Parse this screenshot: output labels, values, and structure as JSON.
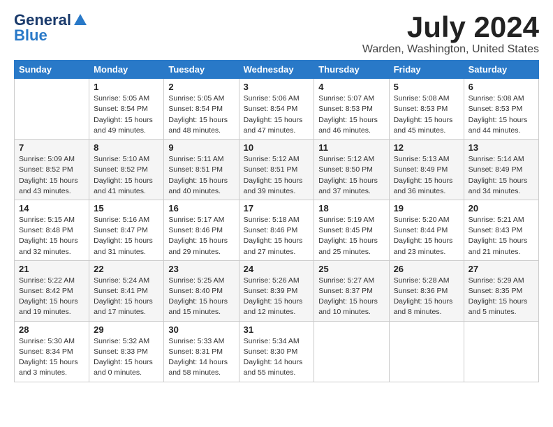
{
  "logo": {
    "line1": "General",
    "line2": "Blue"
  },
  "title": "July 2024",
  "location": "Warden, Washington, United States",
  "headers": [
    "Sunday",
    "Monday",
    "Tuesday",
    "Wednesday",
    "Thursday",
    "Friday",
    "Saturday"
  ],
  "weeks": [
    [
      {
        "day": "",
        "sunrise": "",
        "sunset": "",
        "daylight": ""
      },
      {
        "day": "1",
        "sunrise": "Sunrise: 5:05 AM",
        "sunset": "Sunset: 8:54 PM",
        "daylight": "Daylight: 15 hours and 49 minutes."
      },
      {
        "day": "2",
        "sunrise": "Sunrise: 5:05 AM",
        "sunset": "Sunset: 8:54 PM",
        "daylight": "Daylight: 15 hours and 48 minutes."
      },
      {
        "day": "3",
        "sunrise": "Sunrise: 5:06 AM",
        "sunset": "Sunset: 8:54 PM",
        "daylight": "Daylight: 15 hours and 47 minutes."
      },
      {
        "day": "4",
        "sunrise": "Sunrise: 5:07 AM",
        "sunset": "Sunset: 8:53 PM",
        "daylight": "Daylight: 15 hours and 46 minutes."
      },
      {
        "day": "5",
        "sunrise": "Sunrise: 5:08 AM",
        "sunset": "Sunset: 8:53 PM",
        "daylight": "Daylight: 15 hours and 45 minutes."
      },
      {
        "day": "6",
        "sunrise": "Sunrise: 5:08 AM",
        "sunset": "Sunset: 8:53 PM",
        "daylight": "Daylight: 15 hours and 44 minutes."
      }
    ],
    [
      {
        "day": "7",
        "sunrise": "Sunrise: 5:09 AM",
        "sunset": "Sunset: 8:52 PM",
        "daylight": "Daylight: 15 hours and 43 minutes."
      },
      {
        "day": "8",
        "sunrise": "Sunrise: 5:10 AM",
        "sunset": "Sunset: 8:52 PM",
        "daylight": "Daylight: 15 hours and 41 minutes."
      },
      {
        "day": "9",
        "sunrise": "Sunrise: 5:11 AM",
        "sunset": "Sunset: 8:51 PM",
        "daylight": "Daylight: 15 hours and 40 minutes."
      },
      {
        "day": "10",
        "sunrise": "Sunrise: 5:12 AM",
        "sunset": "Sunset: 8:51 PM",
        "daylight": "Daylight: 15 hours and 39 minutes."
      },
      {
        "day": "11",
        "sunrise": "Sunrise: 5:12 AM",
        "sunset": "Sunset: 8:50 PM",
        "daylight": "Daylight: 15 hours and 37 minutes."
      },
      {
        "day": "12",
        "sunrise": "Sunrise: 5:13 AM",
        "sunset": "Sunset: 8:49 PM",
        "daylight": "Daylight: 15 hours and 36 minutes."
      },
      {
        "day": "13",
        "sunrise": "Sunrise: 5:14 AM",
        "sunset": "Sunset: 8:49 PM",
        "daylight": "Daylight: 15 hours and 34 minutes."
      }
    ],
    [
      {
        "day": "14",
        "sunrise": "Sunrise: 5:15 AM",
        "sunset": "Sunset: 8:48 PM",
        "daylight": "Daylight: 15 hours and 32 minutes."
      },
      {
        "day": "15",
        "sunrise": "Sunrise: 5:16 AM",
        "sunset": "Sunset: 8:47 PM",
        "daylight": "Daylight: 15 hours and 31 minutes."
      },
      {
        "day": "16",
        "sunrise": "Sunrise: 5:17 AM",
        "sunset": "Sunset: 8:46 PM",
        "daylight": "Daylight: 15 hours and 29 minutes."
      },
      {
        "day": "17",
        "sunrise": "Sunrise: 5:18 AM",
        "sunset": "Sunset: 8:46 PM",
        "daylight": "Daylight: 15 hours and 27 minutes."
      },
      {
        "day": "18",
        "sunrise": "Sunrise: 5:19 AM",
        "sunset": "Sunset: 8:45 PM",
        "daylight": "Daylight: 15 hours and 25 minutes."
      },
      {
        "day": "19",
        "sunrise": "Sunrise: 5:20 AM",
        "sunset": "Sunset: 8:44 PM",
        "daylight": "Daylight: 15 hours and 23 minutes."
      },
      {
        "day": "20",
        "sunrise": "Sunrise: 5:21 AM",
        "sunset": "Sunset: 8:43 PM",
        "daylight": "Daylight: 15 hours and 21 minutes."
      }
    ],
    [
      {
        "day": "21",
        "sunrise": "Sunrise: 5:22 AM",
        "sunset": "Sunset: 8:42 PM",
        "daylight": "Daylight: 15 hours and 19 minutes."
      },
      {
        "day": "22",
        "sunrise": "Sunrise: 5:24 AM",
        "sunset": "Sunset: 8:41 PM",
        "daylight": "Daylight: 15 hours and 17 minutes."
      },
      {
        "day": "23",
        "sunrise": "Sunrise: 5:25 AM",
        "sunset": "Sunset: 8:40 PM",
        "daylight": "Daylight: 15 hours and 15 minutes."
      },
      {
        "day": "24",
        "sunrise": "Sunrise: 5:26 AM",
        "sunset": "Sunset: 8:39 PM",
        "daylight": "Daylight: 15 hours and 12 minutes."
      },
      {
        "day": "25",
        "sunrise": "Sunrise: 5:27 AM",
        "sunset": "Sunset: 8:37 PM",
        "daylight": "Daylight: 15 hours and 10 minutes."
      },
      {
        "day": "26",
        "sunrise": "Sunrise: 5:28 AM",
        "sunset": "Sunset: 8:36 PM",
        "daylight": "Daylight: 15 hours and 8 minutes."
      },
      {
        "day": "27",
        "sunrise": "Sunrise: 5:29 AM",
        "sunset": "Sunset: 8:35 PM",
        "daylight": "Daylight: 15 hours and 5 minutes."
      }
    ],
    [
      {
        "day": "28",
        "sunrise": "Sunrise: 5:30 AM",
        "sunset": "Sunset: 8:34 PM",
        "daylight": "Daylight: 15 hours and 3 minutes."
      },
      {
        "day": "29",
        "sunrise": "Sunrise: 5:32 AM",
        "sunset": "Sunset: 8:33 PM",
        "daylight": "Daylight: 15 hours and 0 minutes."
      },
      {
        "day": "30",
        "sunrise": "Sunrise: 5:33 AM",
        "sunset": "Sunset: 8:31 PM",
        "daylight": "Daylight: 14 hours and 58 minutes."
      },
      {
        "day": "31",
        "sunrise": "Sunrise: 5:34 AM",
        "sunset": "Sunset: 8:30 PM",
        "daylight": "Daylight: 14 hours and 55 minutes."
      },
      {
        "day": "",
        "sunrise": "",
        "sunset": "",
        "daylight": ""
      },
      {
        "day": "",
        "sunrise": "",
        "sunset": "",
        "daylight": ""
      },
      {
        "day": "",
        "sunrise": "",
        "sunset": "",
        "daylight": ""
      }
    ]
  ]
}
